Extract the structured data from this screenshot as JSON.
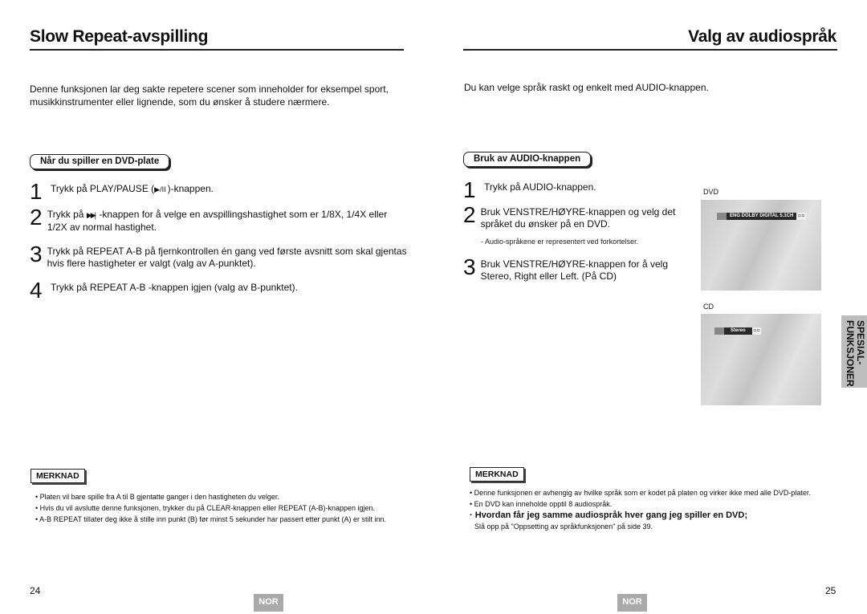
{
  "left": {
    "title": "Slow Repeat-avspilling",
    "intro": "Denne funksjonen lar deg sakte repetere scener som inneholder for eksempel sport, musikkinstrumenter eller lignende, som du ønsker å studere nærmere.",
    "section_label": "Når du spiller en DVD-plate",
    "steps": [
      {
        "num": "1",
        "pre": "Trykk på PLAY/PAUSE (",
        "icon": "▶/II",
        "post": ")-knappen."
      },
      {
        "num": "2",
        "pre": "Trykk på ",
        "icon": "▶▶|",
        "post": " -knappen for å velge en avspillingshastighet som er 1/8X, 1/4X eller 1/2X av normal hastighet."
      },
      {
        "num": "3",
        "text": "Trykk på REPEAT A-B på fjernkontrollen én gang ved første avsnitt som skal gjentas hvis flere hastigheter er valgt (valg av A-punktet)."
      },
      {
        "num": "4",
        "text": "Trykk på REPEAT A-B -knappen igjen (valg av B-punktet)."
      }
    ],
    "note_label": "MERKNAD",
    "notes": [
      "• Platen vil bare spille fra A til B gjentatte ganger i den hastigheten du velger.",
      "• Hvis du vil avslutte denne funksjonen, trykker du på CLEAR-knappen eller REPEAT (A-B)-knappen igjen.",
      "• A-B REPEAT tillater deg ikke å stille inn punkt (B) før minst 5 sekunder har passert etter punkt (A) er stilt inn."
    ],
    "page_number": "24",
    "lang_badge": "NOR"
  },
  "right": {
    "title": "Valg av audiospråk",
    "intro": "Du kan velge språk raskt og enkelt med AUDIO-knappen.",
    "section_label": "Bruk av AUDIO-knappen",
    "steps": [
      {
        "num": "1",
        "text": "Trykk på AUDIO-knappen."
      },
      {
        "num": "2",
        "text": "Bruk VENSTRE/HØYRE-knappen og velg det språket du ønsker på en DVD."
      },
      {
        "num": "3",
        "text": "Bruk VENSTRE/HØYRE-knappen for å velg Stereo, Right eller Left. (På CD)"
      }
    ],
    "step2_sub": "- Audio-språkene er representert ved forkortelser.",
    "dvd_label": "DVD",
    "dvd_osd": "ENG  DOLBY DIGITAL  5.1CH",
    "cd_label": "CD",
    "cd_osd": "Stereo",
    "osd_controls": "◘ ◘",
    "side_tab": "SPESIAL-\nFUNKSJONER",
    "side_tab_line1": "SPESIAL-",
    "side_tab_line2": "FUNKSJONER",
    "note_label": "MERKNAD",
    "notes": [
      "• Denne funksjonen er avhengig av hvilke språk som er kodet på platen og virker ikke med alle DVD-plater.",
      "• En DVD kan inneholde opptil 8 audiospråk."
    ],
    "note_bold": "· Hvordan får jeg samme audiospråk hver gang jeg spiller en DVD;",
    "note_ref": "Slå opp på \"Oppsetting av språkfunksjonen\" på side 39.",
    "page_number": "25",
    "lang_badge": "NOR"
  }
}
